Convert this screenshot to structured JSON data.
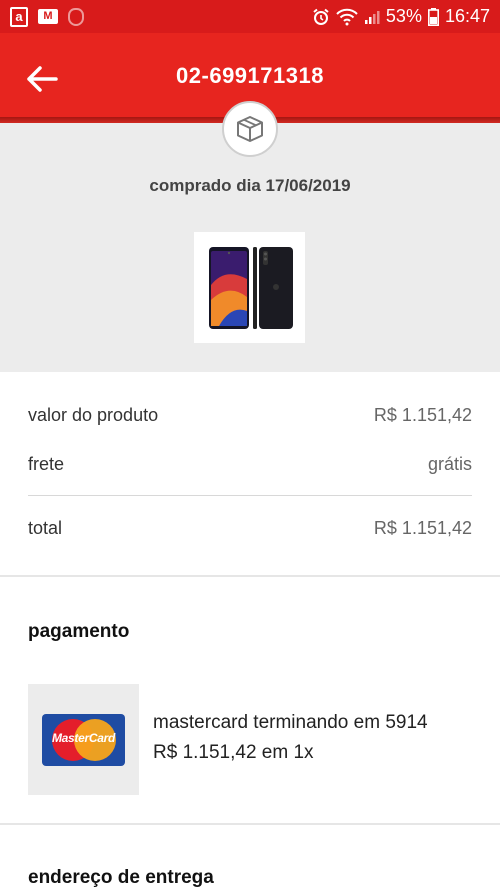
{
  "status_bar": {
    "icons_left": [
      "amazon-app-icon",
      "gmail-icon",
      "shield-icon"
    ],
    "icons_right": [
      "alarm-icon",
      "wifi-icon",
      "signal-icon",
      "battery-icon"
    ],
    "battery": "53%",
    "time": "16:47",
    "color": "#d81b1b"
  },
  "header": {
    "title": "02-699171318",
    "back_icon": "arrow-left-icon",
    "color": "#e7251f"
  },
  "order": {
    "badge_icon": "package-box-icon",
    "purchase_date": "comprado dia 17/06/2019",
    "product_image": "smartphone-product-image"
  },
  "summary": {
    "product_label": "valor do produto",
    "product_value": "R$ 1.151,42",
    "shipping_label": "frete",
    "shipping_value": "grátis",
    "total_label": "total",
    "total_value": "R$ 1.151,42"
  },
  "payment": {
    "title": "pagamento",
    "card_logo_text": "MasterCard",
    "card_line": "mastercard terminando em 5914",
    "amount_line": "R$ 1.151,42 em 1x"
  },
  "delivery": {
    "title": "endereço de entrega"
  }
}
